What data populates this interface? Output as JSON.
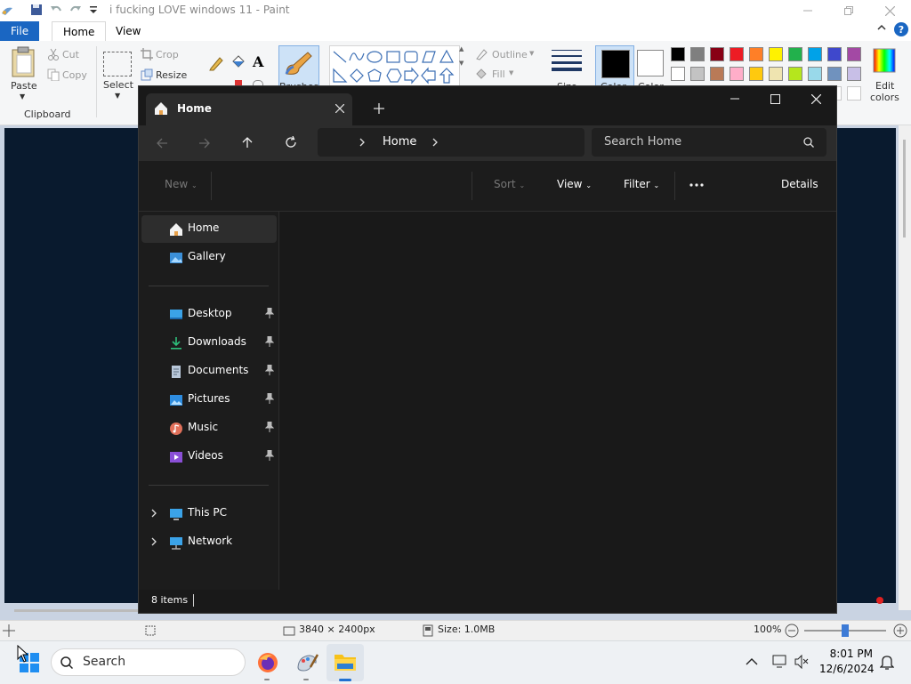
{
  "paint": {
    "window_title": "i fucking LOVE windows 11 - Paint",
    "tabs": {
      "file": "File",
      "home": "Home",
      "view": "View"
    },
    "ribbon": {
      "paste": "Paste",
      "cut": "Cut",
      "copy": "Copy",
      "crop": "Crop",
      "resize": "Resize",
      "select": "Select",
      "clipboard": "Clipboard",
      "brushes": "Brushes",
      "outline": "Outline",
      "fill": "Fill",
      "size": "Size",
      "color1": "Color",
      "color2": "Color",
      "edit_colors_1": "Edit",
      "edit_colors_2": "colors"
    },
    "palette_row1": [
      "#000000",
      "#7f7f7f",
      "#880015",
      "#ed1c24",
      "#ff7f27",
      "#fff200",
      "#22b14c",
      "#00a2e8",
      "#3f48cc",
      "#a349a4"
    ],
    "palette_row2": [
      "#ffffff",
      "#c3c3c3",
      "#b97a57",
      "#ffaec9",
      "#ffc90e",
      "#efe4b0",
      "#b5e61d",
      "#99d9ea",
      "#7092be",
      "#c8bfe7"
    ],
    "status": {
      "dimensions": "3840 × 2400px",
      "size": "Size: 1.0MB",
      "zoom": "100%"
    },
    "zoom_fraction": 0.5
  },
  "explorer": {
    "tab_title": "Home",
    "address": "Home",
    "search_placeholder": "Search Home",
    "commands": {
      "new": "New",
      "sort": "Sort",
      "view": "View",
      "filter": "Filter",
      "details": "Details"
    },
    "nav": {
      "home": "Home",
      "gallery": "Gallery",
      "desktop": "Desktop",
      "downloads": "Downloads",
      "documents": "Documents",
      "pictures": "Pictures",
      "music": "Music",
      "videos": "Videos",
      "this_pc": "This PC",
      "network": "Network"
    },
    "status": "8 items"
  },
  "taskbar": {
    "search": "Search",
    "time": "8:01 PM",
    "date": "12/6/2024"
  }
}
